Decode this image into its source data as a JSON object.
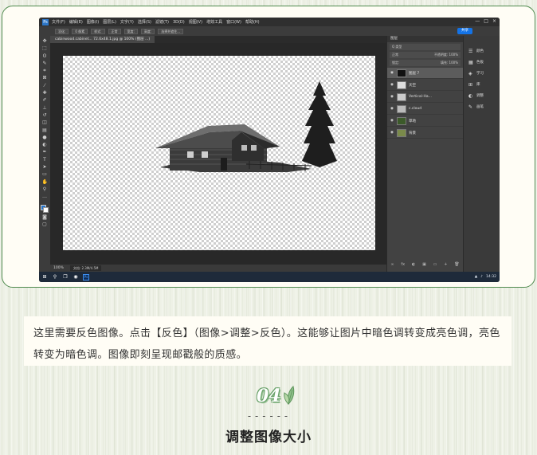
{
  "photoshop": {
    "logo": "Ps",
    "menu": [
      "文件(F)",
      "编辑(E)",
      "图像(I)",
      "图层(L)",
      "文字(Y)",
      "选择(S)",
      "滤镜(T)",
      "3D(D)",
      "视图(V)",
      "增效工具",
      "窗口(W)",
      "帮助(H)"
    ],
    "window_controls": [
      "—",
      "□",
      "×"
    ],
    "options": [
      "羽化:",
      "0 像素",
      "样式:",
      "正常",
      "宽度:",
      "高度:",
      "选择并遮住..."
    ],
    "share_label": "共享",
    "document_tab": "cabinwood.cabinet... 72.6x48.1.jpg @ 100% (图层 ...)",
    "status_zoom": "100%",
    "status_info": "文档: 2.3M/4.5M",
    "layers_panel": {
      "title": "图层",
      "filter_label": "Q 类型",
      "blend_mode": "正常",
      "opacity_label": "不透明度: 100%",
      "lock_label": "锁定:",
      "fill_label": "填充: 100%",
      "layers": [
        {
          "name": "图层 7",
          "active": true,
          "thumb": "#111111"
        },
        {
          "name": "天空",
          "active": false,
          "thumb": "#dddddd"
        },
        {
          "name": "Vertical-Ha...",
          "active": false,
          "thumb": "#cccccc"
        },
        {
          "name": "c.cloud",
          "active": false,
          "thumb": "#bbbbbb"
        },
        {
          "name": "草地",
          "active": false,
          "thumb": "#3c5a2a"
        },
        {
          "name": "背景",
          "active": false,
          "thumb": "#7a8a4a"
        }
      ],
      "footer_icons": [
        "∞",
        "fx",
        "◐",
        "▣",
        "▭",
        "+",
        "🗑"
      ]
    },
    "dock": [
      {
        "icon": "☰",
        "label": "颜色"
      },
      {
        "icon": "▦",
        "label": "色板"
      },
      {
        "icon": "◈",
        "label": "学习"
      },
      {
        "icon": "⊞",
        "label": "库"
      },
      {
        "icon": "◐",
        "label": "调整"
      },
      {
        "icon": "✎",
        "label": "画笔"
      }
    ],
    "taskbar_clock": "14:32"
  },
  "caption": "这里需要反色图像。点击【反色】（图像>调整>反色）。这能够让图片中暗色调转变成亮色调，亮色转变为暗色调。图像即刻呈现邮戳般的质感。",
  "step_number": "04",
  "dashes": "------",
  "section_title": "调整图像大小"
}
